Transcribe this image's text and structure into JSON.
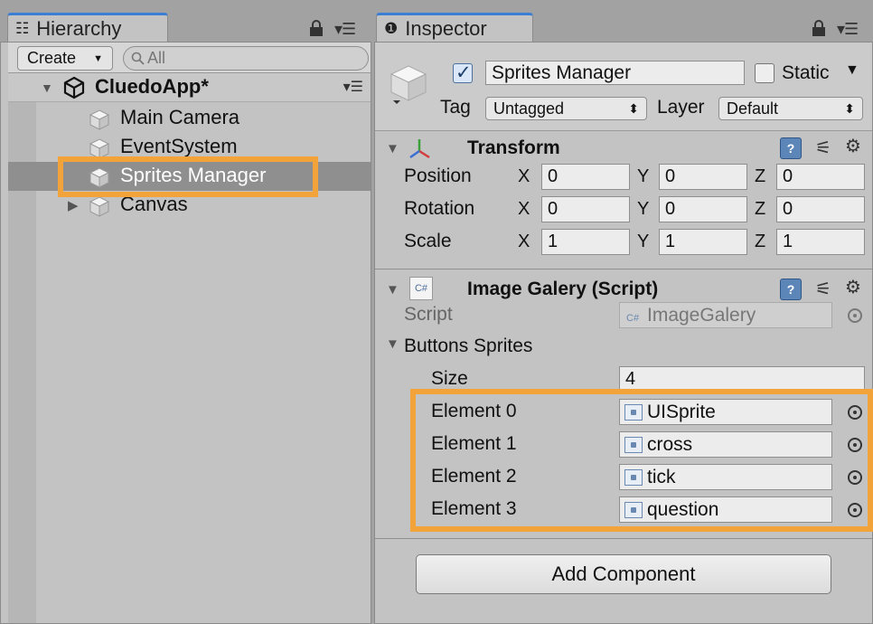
{
  "hierarchy": {
    "tab_label": "Hierarchy",
    "create_label": "Create",
    "search_placeholder": "All",
    "scene_name": "CluedoApp*",
    "items": [
      {
        "label": "Main Camera",
        "selected": false,
        "expandable": false
      },
      {
        "label": "EventSystem",
        "selected": false,
        "expandable": false
      },
      {
        "label": "Sprites Manager",
        "selected": true,
        "expandable": false
      },
      {
        "label": "Canvas",
        "selected": false,
        "expandable": true
      }
    ]
  },
  "inspector": {
    "tab_label": "Inspector",
    "object": {
      "active": true,
      "name": "Sprites Manager",
      "static_label": "Static",
      "static_checked": false,
      "tag_label": "Tag",
      "tag_value": "Untagged",
      "layer_label": "Layer",
      "layer_value": "Default"
    },
    "transform": {
      "title": "Transform",
      "rows": [
        {
          "label": "Position",
          "x": "0",
          "y": "0",
          "z": "0"
        },
        {
          "label": "Rotation",
          "x": "0",
          "y": "0",
          "z": "0"
        },
        {
          "label": "Scale",
          "x": "1",
          "y": "1",
          "z": "1"
        }
      ],
      "axis_labels": {
        "x": "X",
        "y": "Y",
        "z": "Z"
      }
    },
    "script_component": {
      "title": "Image Galery (Script)",
      "icon_text": "C#",
      "script_label": "Script",
      "script_value": "ImageGalery",
      "array_label": "Buttons Sprites",
      "size_label": "Size",
      "size_value": "4",
      "elements": [
        {
          "label": "Element 0",
          "value": "UISprite"
        },
        {
          "label": "Element 1",
          "value": "cross"
        },
        {
          "label": "Element 2",
          "value": "tick"
        },
        {
          "label": "Element 3",
          "value": "question"
        }
      ]
    },
    "add_component_label": "Add Component"
  },
  "colors": {
    "highlight": "#f2a43a",
    "selection": "#8f8f8f",
    "active_tab_accent": "#3b7fd4",
    "panel_bg": "#c3c3c3"
  }
}
